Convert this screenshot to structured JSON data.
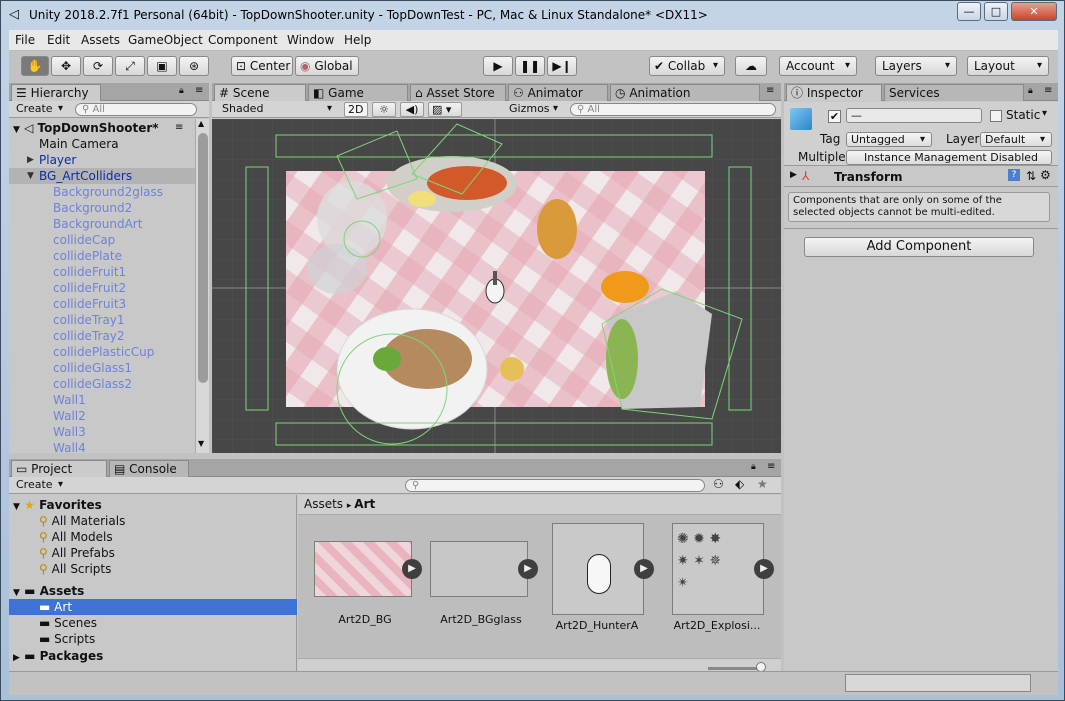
{
  "window": {
    "title": "Unity 2018.2.7f1 Personal (64bit) - TopDownShooter.unity - TopDownTest - PC, Mac & Linux Standalone* <DX11>"
  },
  "menu": [
    "File",
    "Edit",
    "Assets",
    "GameObject",
    "Component",
    "Window",
    "Help"
  ],
  "toolbar": {
    "pivot": "Center",
    "space": "Global",
    "collab": "Collab",
    "account": "Account",
    "layers": "Layers",
    "layout": "Layout"
  },
  "hierarchy": {
    "tab": "Hierarchy",
    "create": "Create",
    "search_placeholder": "All",
    "scene": "TopDownShooter*",
    "items": [
      {
        "label": "Main Camera",
        "indent": 1,
        "style": "normal"
      },
      {
        "label": "Player",
        "indent": 1,
        "style": "blue",
        "arrow": "▶"
      },
      {
        "label": "BG_ArtColliders",
        "indent": 1,
        "style": "blue",
        "arrow": "▼"
      },
      {
        "label": "Background2glass",
        "indent": 2,
        "style": "ghost"
      },
      {
        "label": "Background2",
        "indent": 2,
        "style": "ghost"
      },
      {
        "label": "BackgroundArt",
        "indent": 2,
        "style": "ghost"
      },
      {
        "label": "collideCap",
        "indent": 2,
        "style": "ghost"
      },
      {
        "label": "collidePlate",
        "indent": 2,
        "style": "ghost"
      },
      {
        "label": "collideFruit1",
        "indent": 2,
        "style": "ghost"
      },
      {
        "label": "collideFruit2",
        "indent": 2,
        "style": "ghost"
      },
      {
        "label": "collideFruit3",
        "indent": 2,
        "style": "ghost"
      },
      {
        "label": "collideTray1",
        "indent": 2,
        "style": "ghost"
      },
      {
        "label": "collideTray2",
        "indent": 2,
        "style": "ghost"
      },
      {
        "label": "collidePlasticCup",
        "indent": 2,
        "style": "ghost"
      },
      {
        "label": "collideGlass1",
        "indent": 2,
        "style": "ghost"
      },
      {
        "label": "collideGlass2",
        "indent": 2,
        "style": "ghost"
      },
      {
        "label": "Wall1",
        "indent": 2,
        "style": "ghost"
      },
      {
        "label": "Wall2",
        "indent": 2,
        "style": "ghost"
      },
      {
        "label": "Wall3",
        "indent": 2,
        "style": "ghost"
      },
      {
        "label": "Wall4",
        "indent": 2,
        "style": "ghost"
      }
    ]
  },
  "scene_view": {
    "tabs": [
      "Scene",
      "Game",
      "Asset Store",
      "Animator",
      "Animation"
    ],
    "shading": "Shaded",
    "mode_2d": "2D",
    "gizmos": "Gizmos",
    "search_placeholder": "All"
  },
  "inspector": {
    "tabs": [
      "Inspector",
      "Services"
    ],
    "name_value": "—",
    "static_label": "Static",
    "tag_label": "Tag",
    "tag_value": "Untagged",
    "layer_label": "Layer",
    "layer_value": "Default",
    "multiple_label": "Multiple",
    "instance_mgmt": "Instance Management Disabled",
    "component": "Transform",
    "warning": "Components that are only on some of the selected objects cannot be multi-edited.",
    "add_component": "Add Component"
  },
  "project": {
    "tabs": [
      "Project",
      "Console"
    ],
    "create": "Create",
    "favorites_label": "Favorites",
    "favorites": [
      "All Materials",
      "All Models",
      "All Prefabs",
      "All Scripts"
    ],
    "assets_label": "Assets",
    "asset_folders": [
      "Art",
      "Scenes",
      "Scripts"
    ],
    "packages_label": "Packages",
    "breadcrumb": [
      "Assets",
      "Art"
    ],
    "assets": [
      "Art2D_BG",
      "Art2D_BGglass",
      "Art2D_HunterA",
      "Art2D_Explosi..."
    ]
  },
  "colors": {
    "selection": "#3d73d6",
    "scene_bg": "#474747",
    "collider": "#7fd47a"
  }
}
